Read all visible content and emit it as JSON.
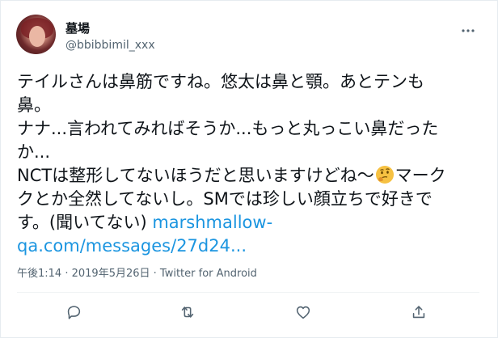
{
  "user": {
    "display_name": "墓場",
    "handle": "@bbibbimil_xxx"
  },
  "tweet": {
    "lines": [
      "テイルさんは鼻筋ですね。悠太は鼻と顎。あとテンも",
      "鼻。",
      "ナナ...言われてみればそうか...もっと丸っこい鼻だった",
      "か...",
      "NCTは整形してないほうだと思いますけどね〜",
      "マーク",
      "クとか全然してないし。SMでは珍しい顔立ちで好きで",
      "す。(聞いてない) ",
      "marshmallow-",
      "qa.com/messages/27d24..."
    ],
    "emoji": "thinking-face"
  },
  "meta": {
    "time": "午後1:14",
    "separator1": " · ",
    "date": "2019年5月26日",
    "separator2": " · ",
    "source": "Twitter for Android"
  },
  "colors": {
    "link": "#1b95e0",
    "text": "#0f1419",
    "secondary": "#536471",
    "icon": "#536471"
  },
  "icons": [
    "more-icon",
    "reply-icon",
    "retweet-icon",
    "like-icon",
    "share-icon"
  ]
}
